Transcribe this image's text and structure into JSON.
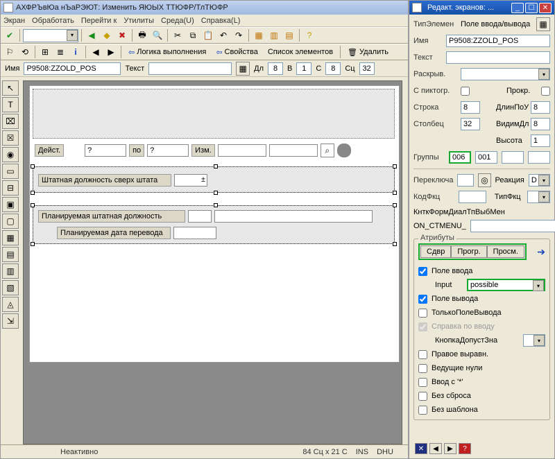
{
  "left": {
    "title": "АХФРЪвЮа нЪаРЭЮТ: Изменить ЯЮЫХ ТТЮФР/ТлТЮФР",
    "menu": [
      "Экран",
      "Обработать",
      "Перейти к",
      "Утилиты",
      "Среда(U)",
      "Справка(L)"
    ],
    "namebar": {
      "name_label": "Имя",
      "name_value": "P9508:ZZOLD_POS",
      "text_label": "Текст",
      "dl_label": "Дл",
      "dl": "8",
      "v_label": "В",
      "v": "1",
      "s_label": "С",
      "s": "8",
      "sc_label": "Сц",
      "sc": "32"
    },
    "canvas": {
      "deyst": "Дейст.",
      "q1": "?",
      "po": "по",
      "q2": "?",
      "izm": "Изм.",
      "row1": "Штатная должность сверх штата",
      "row2": "Планируемая штатная должность",
      "row3": "Планируемая дата перевода"
    },
    "toolbar2": {
      "logic": "Логика выполнения",
      "props": "Свойства",
      "elems": "Список элементов",
      "delete": "Удалить"
    },
    "status": {
      "inactive": "Неактивно",
      "pos": "84 Сц x 21 С",
      "ins": "INS",
      "dhu": "DHU"
    }
  },
  "right": {
    "title": "Редакт. экранов: ...",
    "type_label": "ТипЭлемен",
    "type_value": "Поле ввода/вывода",
    "name_label": "Имя",
    "name_value": "P9508:ZZOLD_POS",
    "text_label": "Текст",
    "raskryv": "Раскрыв.",
    "spiktogr": "С пиктогр.",
    "prokr": "Прокр.",
    "stroka": "Строка",
    "stroka_v": "8",
    "dlinpou": "ДлинПоУ",
    "dlinpou_v": "8",
    "stolb": "Столбец",
    "stolb_v": "32",
    "vidimdl": "ВидимДл",
    "vidimdl_v": "8",
    "vysota": "Высота",
    "vysota_v": "1",
    "gruppy": "Группы",
    "g1": "006",
    "g2": "001",
    "pereklucha": "Переключа",
    "reakcia": "Реакция",
    "reakcia_v": "D",
    "kodfkc": "КодФкц",
    "tipfkc": "ТипФкц",
    "cntk": "КнткФормДиалТпВыбМен",
    "oncm": "ON_CTMENU_",
    "attrs": {
      "title": "Атрибуты",
      "t1": "Сдвр",
      "t2": "Прогр.",
      "t3": "Просм.",
      "c1": "Поле ввода",
      "input_label": "Input",
      "input_value": "possible",
      "c2": "Поле вывода",
      "c3": "ТолькоПолеВывода",
      "c4": "Справка по вводу",
      "c5": "КнопкаДопустЗна",
      "c6": "Правое выравн.",
      "c7": "Ведущие нули",
      "c8": "Ввод с '*'",
      "c9": "Без сброса",
      "c10": "Без шаблона"
    }
  }
}
